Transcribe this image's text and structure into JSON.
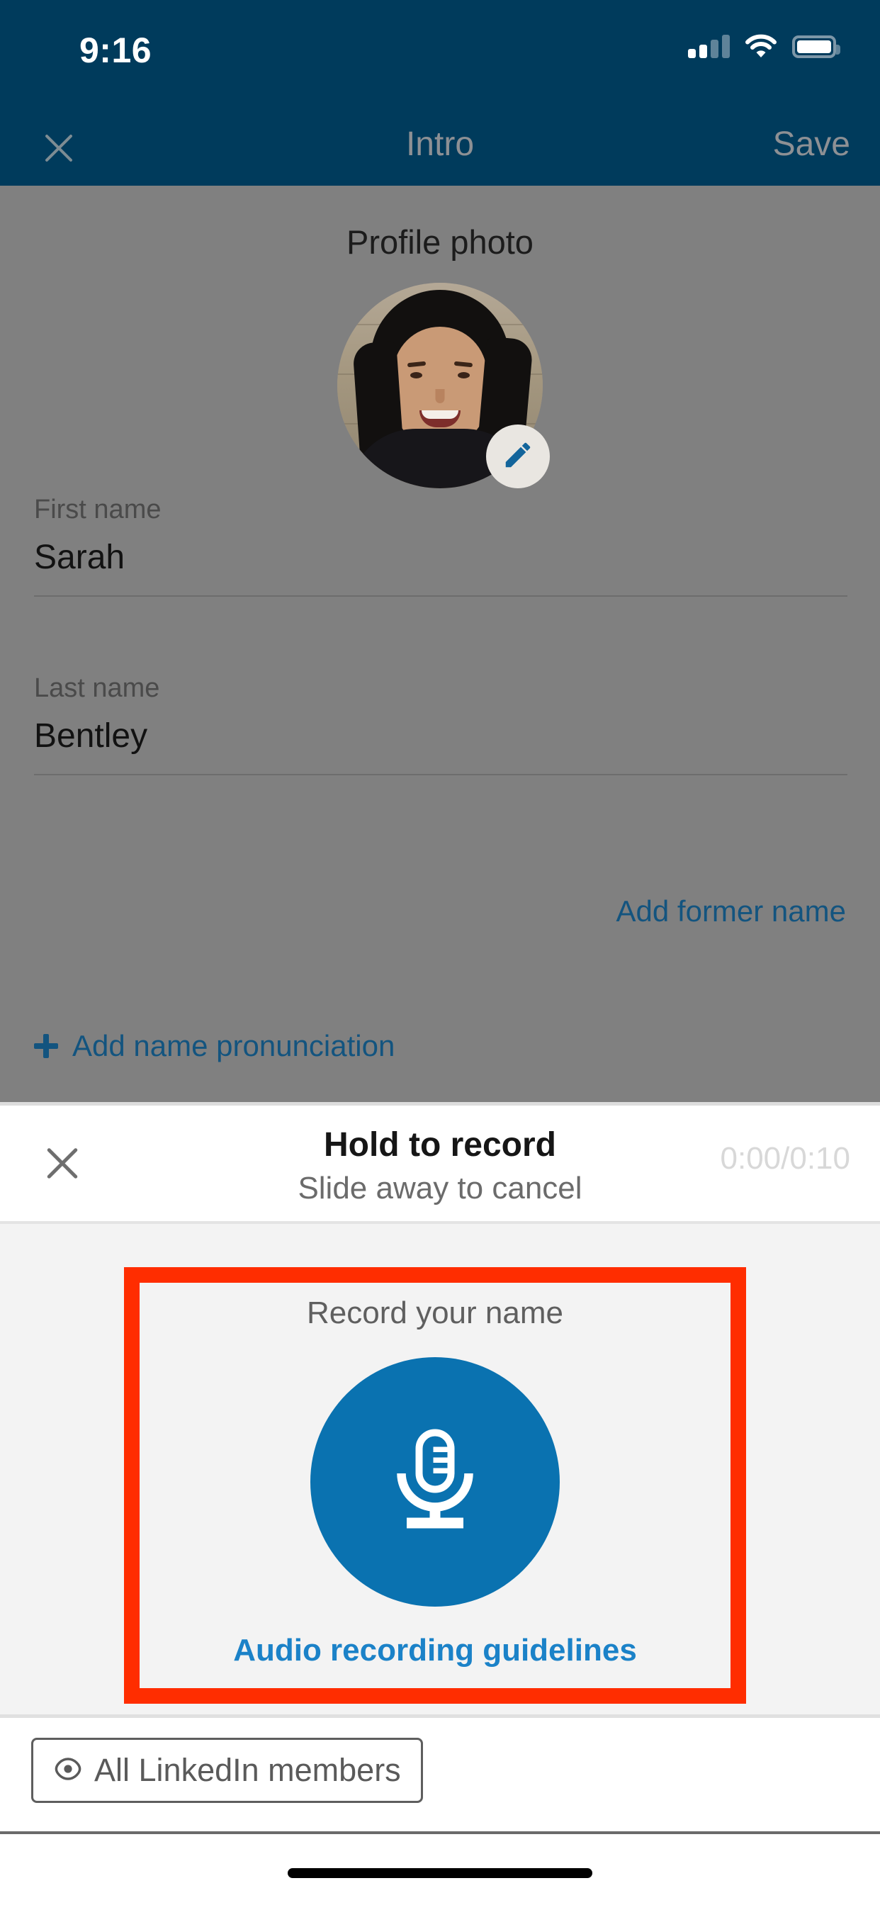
{
  "status_bar": {
    "time": "9:16",
    "icons": [
      "cellular-signal-icon",
      "wifi-icon",
      "battery-icon"
    ]
  },
  "nav_bar": {
    "close_icon": "close-icon",
    "title": "Intro",
    "save_label": "Save"
  },
  "form": {
    "photo_label": "Profile photo",
    "edit_photo_icon": "pencil-icon",
    "first_name": {
      "label": "First name",
      "value": "Sarah"
    },
    "last_name": {
      "label": "Last name",
      "value": "Bentley"
    },
    "former_name_link": "Add former name",
    "pronunciation_link": "Add name pronunciation",
    "pronunciation_icon": "plus-icon"
  },
  "recorder": {
    "close_icon": "close-icon",
    "title": "Hold to record",
    "subtitle": "Slide away to cancel",
    "timer": "0:00/0:10",
    "record_label": "Record your name",
    "mic_icon": "microphone-icon",
    "guidelines_link": "Audio recording guidelines",
    "highlight_color": "#ff2d00"
  },
  "visibility": {
    "icon": "eye-icon",
    "label": "All LinkedIn members"
  },
  "colors": {
    "brand_dark_blue": "#003B5C",
    "brand_blue": "#0a72b0",
    "link_blue": "#1b82c8",
    "overlay_gray": "#808080",
    "panel_gray": "#f3f3f3"
  }
}
